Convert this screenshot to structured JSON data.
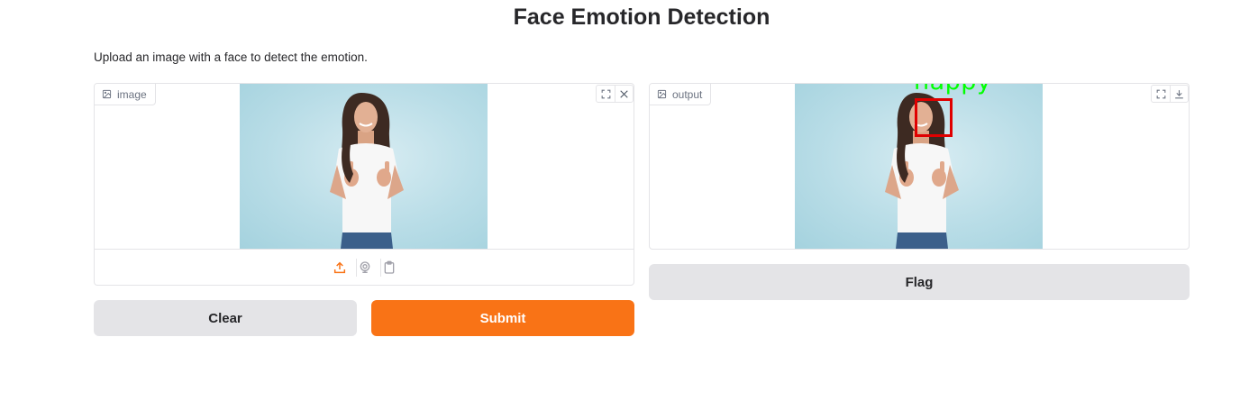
{
  "page": {
    "title": "Face Emotion Detection",
    "description": "Upload an image with a face to detect the emotion."
  },
  "input_panel": {
    "label": "image",
    "image_alt": "Woman in white t-shirt giving two thumbs up"
  },
  "output_panel": {
    "label": "output",
    "detected_emotion": "happy",
    "box_color": "#e00000",
    "text_color": "#00ff00"
  },
  "buttons": {
    "clear": "Clear",
    "submit": "Submit",
    "flag": "Flag"
  },
  "colors": {
    "primary": "#f97316",
    "secondary": "#e4e4e7",
    "border": "#e4e4e7"
  },
  "icons": {
    "fullscreen": "fullscreen-icon",
    "close": "close-icon",
    "download": "download-icon",
    "upload": "upload-icon",
    "webcam": "webcam-icon",
    "clipboard": "clipboard-icon",
    "image": "image-icon"
  }
}
